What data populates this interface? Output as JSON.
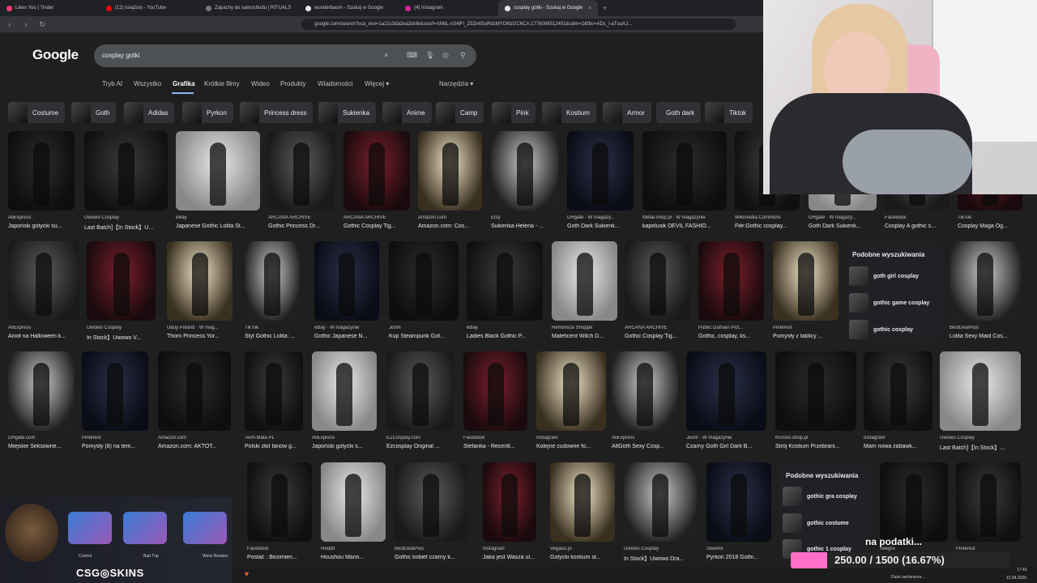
{
  "browser": {
    "tabs": [
      {
        "label": "Likes You | Tinder",
        "color": "#fe3c72"
      },
      {
        "label": "(12) książulo - YouTube",
        "color": "#ff0000"
      },
      {
        "label": "Zapachy do samochodu | RITUALS",
        "color": "#777777"
      },
      {
        "label": "wunderbaum - Szukaj w Google",
        "color": "#e8eaed"
      },
      {
        "label": "(4) Instagram",
        "color": "#d6249f"
      },
      {
        "label": "cosplay gotki - Szukaj w Google",
        "color": "#e8eaed"
      }
    ],
    "new_tab": "+",
    "close": "×",
    "url": "google.com/search?sca_esv=1a21c3da2ea2dcfe&sxsrf=ANbL-nS4lFI_Z3ZmtSuRdzMYD6lzGC6CA:1776008512451&udm=2&fbs=ADc_l-aTuuAJ..."
  },
  "google": {
    "logo": "Google",
    "query": "cosplay gotki",
    "clear": "×",
    "menu": [
      "Tryb AI",
      "Wszystko",
      "Grafika",
      "Krótkie filmy",
      "Wideo",
      "Produkty",
      "Wiadomości",
      "Więcej ▾",
      "Narzędzia ▾"
    ],
    "chips": [
      "Costume",
      "Goth",
      "Adidas",
      "Pyrkon",
      "Princess dress",
      "Sukienka",
      "Anime",
      "Camp",
      "Pink",
      "Kostium",
      "Armor",
      "Goth dark",
      "Tiktok"
    ]
  },
  "results": {
    "row1": [
      {
        "src": "AliExpress",
        "title": "Japoński gotycki su..."
      },
      {
        "src": "Uwowo Cosplay",
        "title": "Last Batch]【In Stock】U..."
      },
      {
        "src": "eBay",
        "title": "Japanese Gothic Lolita St..."
      },
      {
        "src": "ARCANA ARCHIVE",
        "title": "Gothic Princess Dr..."
      },
      {
        "src": "ARCANA ARCHIVE",
        "title": "Gothic Cosplay Tig..."
      },
      {
        "src": "Amazon.com",
        "title": "Amazon.com: Cos..."
      },
      {
        "src": "Etsy",
        "title": "Sukienka Helena - ..."
      },
      {
        "src": "DHgate · W magazy...",
        "title": "Goth Dark Sukienk..."
      },
      {
        "src": "Metal-shop.pl · W magazynie",
        "title": "kapelusik DEVIL FASHIO..."
      },
      {
        "src": "Wikimedia Commons",
        "title": "File:Gothic cosplay..."
      },
      {
        "src": "DHgate · W magazy...",
        "title": "Goth Dark Sukienk..."
      },
      {
        "src": "Facebook",
        "title": "Cosplay A gothic s..."
      },
      {
        "src": "TikTok",
        "title": "Cosplay Maga Og..."
      }
    ],
    "row2": [
      {
        "src": "AliExpress",
        "title": "Anioł na Halloween k..."
      },
      {
        "src": "Uwowo Cosplay",
        "title": "In Stock】Uwowo V..."
      },
      {
        "src": "Ubuy Poland · W mag...",
        "title": "Thorn Princess Yor..."
      },
      {
        "src": "TikTok",
        "title": "Styl Gothic Lolita: ..."
      },
      {
        "src": "eBay · W magazynie",
        "title": "Gothic Japanese N..."
      },
      {
        "src": "Joom",
        "title": "Kup Steampunk Got..."
      },
      {
        "src": "eBay",
        "title": "Ladies Black Gothic P..."
      },
      {
        "src": "Reminisce Shoppe",
        "title": "Maleficent Witch D..."
      },
      {
        "src": "ARCANA ARCHIVE",
        "title": "Gothic Cosplay Tig..."
      },
      {
        "src": "Public Domain Pict...",
        "title": "Gothic, cosplay, ks..."
      },
      {
        "src": "Pinterest",
        "title": "Pomysły z tablicy ..."
      },
      {
        "src": "BestDealPlus",
        "title": "Lolita Sexy Maid Cos..."
      }
    ],
    "row3": [
      {
        "src": "DHgate.com",
        "title": "Miejskie Seksowne..."
      },
      {
        "src": "Pinterest",
        "title": "Pomysły (8) na tem..."
      },
      {
        "src": "Amazon.com",
        "title": "Amazon.com: AKTOT..."
      },
      {
        "src": "Tech-Mate.PL",
        "title": "Polski złot fanów g..."
      },
      {
        "src": "AliExpress",
        "title": "Japoński gotycki s..."
      },
      {
        "src": "EZCosplay.com",
        "title": "Ezcosplay Original ..."
      },
      {
        "src": "Facebook",
        "title": "Stefanka - Recentl..."
      },
      {
        "src": "Instagram",
        "title": "Kolejne cudowne fo..."
      },
      {
        "src": "AliExpress",
        "title": "AltGoth Sexy Cosp..."
      },
      {
        "src": "Joom · W magazynie",
        "title": "Czarny Goth Girl Dark B..."
      },
      {
        "src": "Kronos-shop.pl",
        "title": "Strój Kostium Przebrani..."
      },
      {
        "src": "Instagram",
        "title": "Mam nowa zabawk..."
      },
      {
        "src": "Uwowo Cosplay",
        "title": "Last Batch]【In Stock】..."
      }
    ],
    "row4": [
      {
        "src": "Facebook",
        "title": "Postać : Bezimien..."
      },
      {
        "src": "Reddit",
        "title": "Houshou Marin..."
      },
      {
        "src": "BestDealPlus",
        "title": "Gothic kobiet czarny k..."
      },
      {
        "src": "Instagram",
        "title": "Jaka jest Wasza ul..."
      },
      {
        "src": "Vegaoo.pl",
        "title": "Gotycki kostium st..."
      },
      {
        "src": "Uwowo Cosplay",
        "title": "In Stock】Uwowo Dra..."
      },
      {
        "src": "Steemit",
        "title": "Pyrkon 2018 Gothi..."
      },
      {
        "src": "Allegro",
        "title": ""
      },
      {
        "src": "Pinterest",
        "title": ""
      }
    ]
  },
  "related1": {
    "header": "Podobne wyszukiwania",
    "items": [
      "goth girl cosplay",
      "gothic game cosplay",
      "gothic cosplay"
    ]
  },
  "related2": {
    "header": "Podobne wyszukiwania",
    "items": [
      "gothic gra cosplay",
      "gothic costume",
      "gothic 1 cosplay"
    ]
  },
  "overlay": {
    "guns": [
      "Control",
      "Bad Trip",
      "Wave Breaker"
    ],
    "brand": "CSG◎SKINS",
    "goal_text": "250.00 / 1500 (16.67%)",
    "goal_fraction": 0.1667,
    "caption": "na podatki...",
    "weather": "Duże zachmurze...",
    "time": "17:43",
    "date": "12.04.2026"
  }
}
